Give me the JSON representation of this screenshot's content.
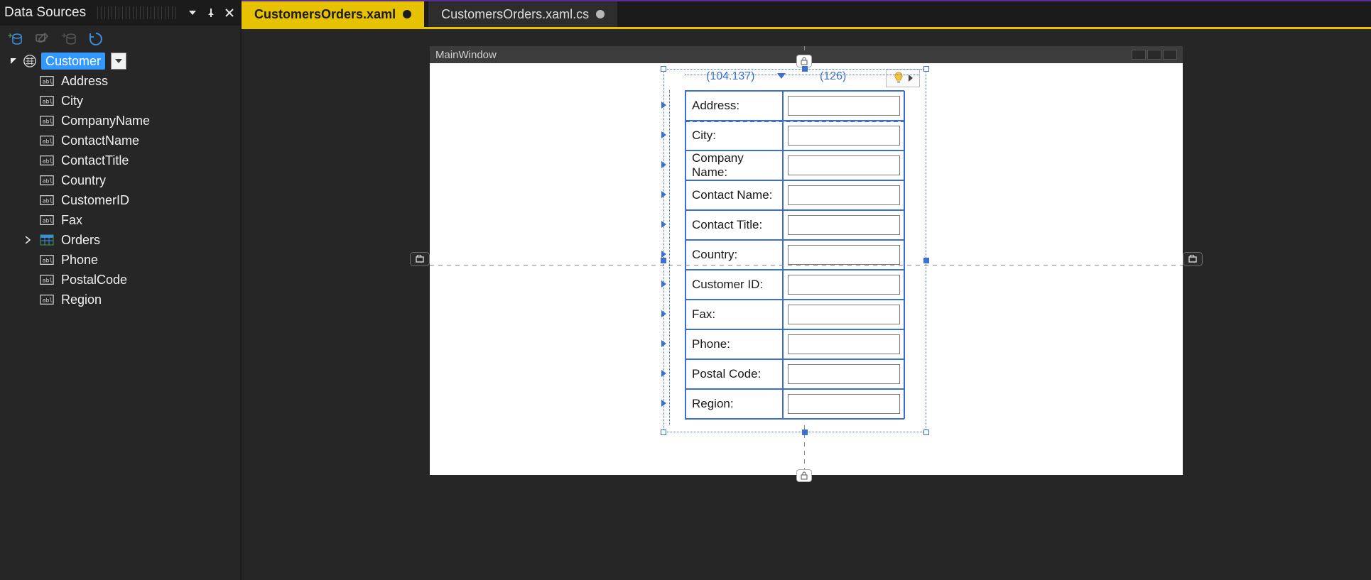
{
  "panel": {
    "title": "Data Sources",
    "root_node": "Customer",
    "fields": [
      "Address",
      "City",
      "CompanyName",
      "ContactName",
      "ContactTitle",
      "Country",
      "CustomerID",
      "Fax",
      "Orders",
      "Phone",
      "PostalCode",
      "Region"
    ]
  },
  "tabs": {
    "active": "CustomersOrders.xaml",
    "inactive": "CustomersOrders.xaml.cs"
  },
  "designer": {
    "window_title": "MainWindow",
    "ruler_col1": "(104.137)",
    "ruler_col2": "(126)",
    "form_labels": [
      "Address:",
      "City:",
      "Company Name:",
      "Contact Name:",
      "Contact Title:",
      "Country:",
      "Customer ID:",
      "Fax:",
      "Phone:",
      "Postal Code:",
      "Region:"
    ]
  }
}
